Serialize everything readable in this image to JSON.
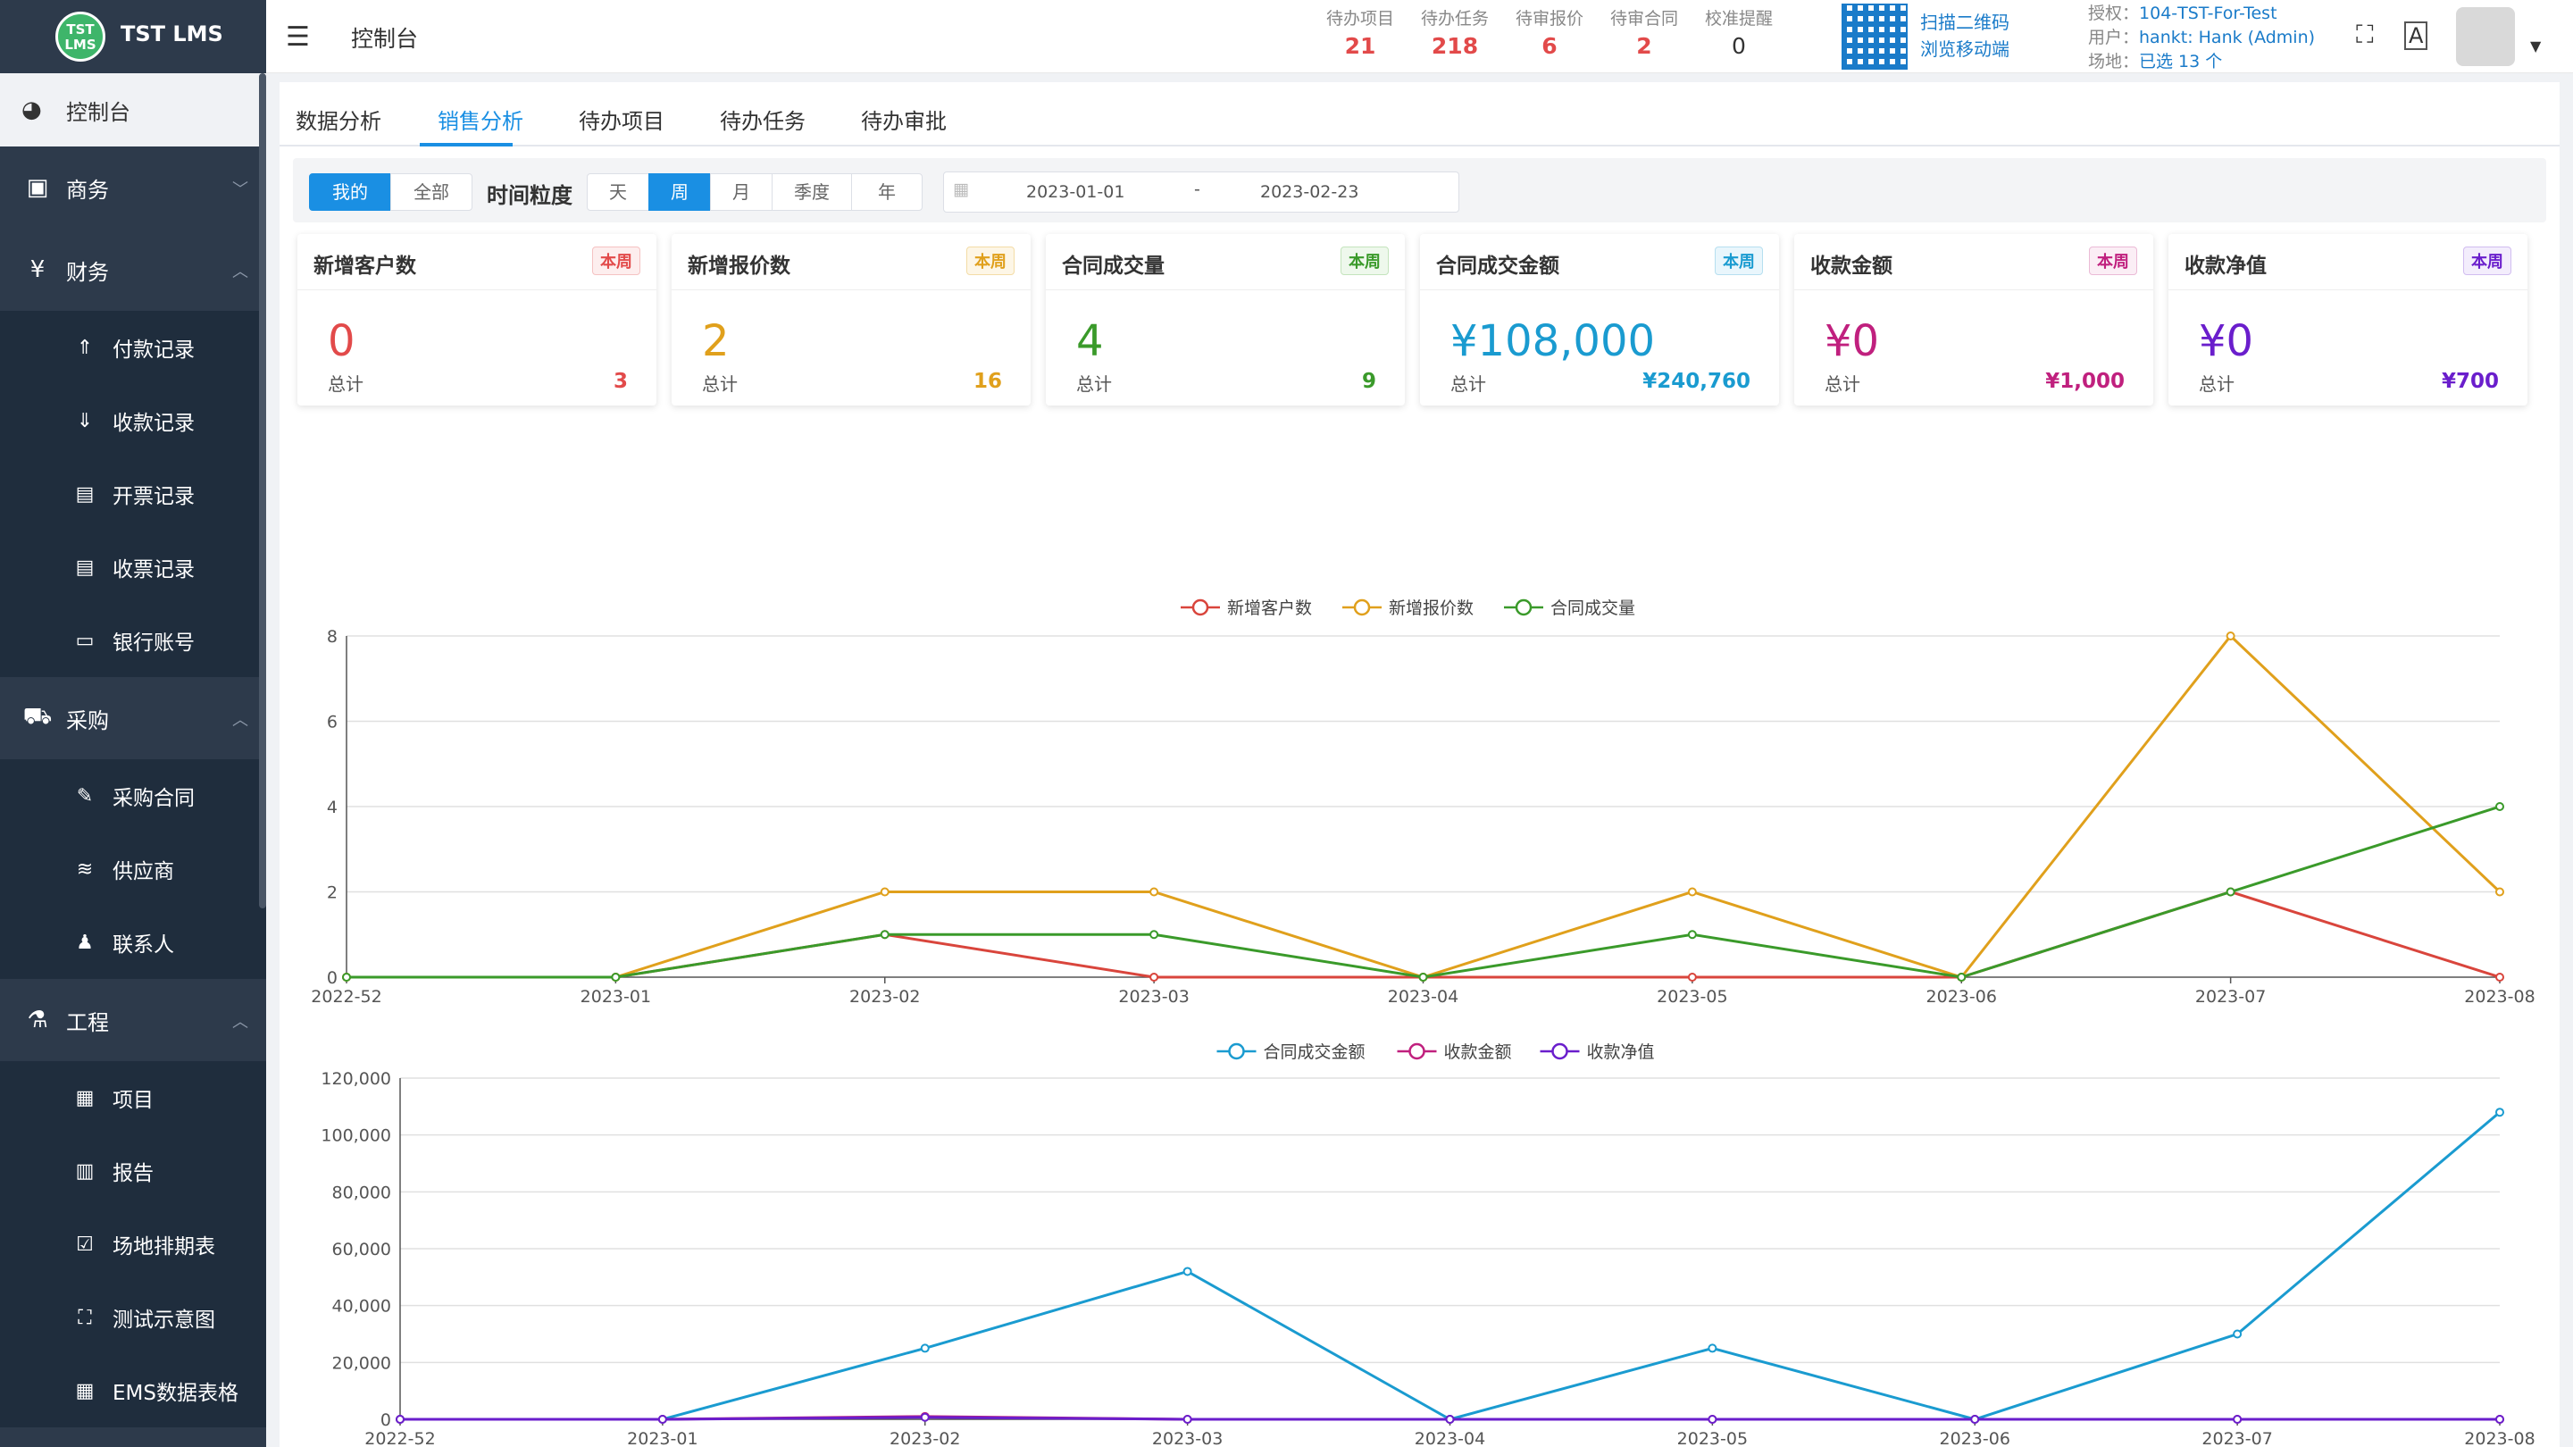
{
  "app": {
    "logo_badge": "TST LMS",
    "title": "TST LMS"
  },
  "sidebar": {
    "active": "控制台",
    "groups": [
      {
        "label": "商务",
        "icon": "briefcase-icon",
        "items": []
      },
      {
        "label": "财务",
        "icon": "yen-icon",
        "items": [
          "付款记录",
          "收款记录",
          "开票记录",
          "收票记录",
          "银行账号"
        ]
      },
      {
        "label": "采购",
        "icon": "cart-icon",
        "items": [
          "采购合同",
          "供应商",
          "联系人"
        ]
      },
      {
        "label": "工程",
        "icon": "flask-icon",
        "items": [
          "项目",
          "报告",
          "场地排期表",
          "测试示意图",
          "EMS数据表格"
        ]
      }
    ]
  },
  "header": {
    "breadcrumb": "控制台",
    "counters": [
      {
        "label": "待办项目",
        "value": "21"
      },
      {
        "label": "待办任务",
        "value": "218"
      },
      {
        "label": "待审报价",
        "value": "6"
      },
      {
        "label": "待审合同",
        "value": "2"
      },
      {
        "label": "校准提醒",
        "value": "0"
      }
    ],
    "qr_text1": "扫描二维码",
    "qr_text2": "浏览移动端",
    "license_label": "授权：",
    "license": "104-TST-For-Test",
    "user_label": "用户：",
    "user": "hankt: Hank (Admin)",
    "site_label": "场地：",
    "site": "已选 13 个"
  },
  "tabs": [
    "数据分析",
    "销售分析",
    "待办项目",
    "待办任务",
    "待办审批"
  ],
  "active_tab": "销售分析",
  "filter": {
    "scope": [
      "我的",
      "全部"
    ],
    "granularity_label": "时间粒度",
    "granularity": [
      "天",
      "周",
      "月",
      "季度",
      "年"
    ],
    "active_granularity": "周",
    "date_from": "2023-01-01",
    "date_sep": "-",
    "date_to": "2023-02-23"
  },
  "cards": [
    {
      "title": "新增客户数",
      "tag": "本周",
      "value": "0",
      "total_label": "总计",
      "total": "3",
      "color": "#e24a4a"
    },
    {
      "title": "新增报价数",
      "tag": "本周",
      "value": "2",
      "total_label": "总计",
      "total": "16",
      "color": "#e0a01c"
    },
    {
      "title": "合同成交量",
      "tag": "本周",
      "value": "4",
      "total_label": "总计",
      "total": "9",
      "color": "#3a9a2a"
    },
    {
      "title": "合同成交金额",
      "tag": "本周",
      "value": "¥108,000",
      "total_label": "总计",
      "total": "¥240,760",
      "color": "#1a9bd0"
    },
    {
      "title": "收款金额",
      "tag": "本周",
      "value": "¥0",
      "total_label": "总计",
      "total": "¥1,000",
      "color": "#c0207e"
    },
    {
      "title": "收款净值",
      "tag": "本周",
      "value": "¥0",
      "total_label": "总计",
      "total": "¥700",
      "color": "#6a1ecc"
    }
  ],
  "chart_data": [
    {
      "type": "line",
      "x": [
        "2022-52",
        "2023-01",
        "2023-02",
        "2023-03",
        "2023-04",
        "2023-05",
        "2023-06",
        "2023-07",
        "2023-08"
      ],
      "ylim": [
        0,
        8
      ],
      "yticks": [
        0,
        2,
        4,
        6,
        8
      ],
      "legend": "top-center",
      "grid": true,
      "series": [
        {
          "name": "新增客户数",
          "color": "#d9453c",
          "values": [
            0,
            0,
            1,
            0,
            0,
            0,
            0,
            2,
            0
          ]
        },
        {
          "name": "新增报价数",
          "color": "#e0a01c",
          "values": [
            0,
            0,
            2,
            2,
            0,
            2,
            0,
            8,
            2
          ]
        },
        {
          "name": "合同成交量",
          "color": "#3a9a2a",
          "values": [
            0,
            0,
            1,
            1,
            0,
            1,
            0,
            2,
            4
          ]
        }
      ]
    },
    {
      "type": "line",
      "x": [
        "2022-52",
        "2023-01",
        "2023-02",
        "2023-03",
        "2023-04",
        "2023-05",
        "2023-06",
        "2023-07",
        "2023-08"
      ],
      "ylim": [
        0,
        120000
      ],
      "yticks": [
        0,
        20000,
        40000,
        60000,
        80000,
        100000,
        120000
      ],
      "legend": "top-center",
      "grid": true,
      "series": [
        {
          "name": "合同成交金额",
          "color": "#1a9bd0",
          "values": [
            0,
            0,
            25000,
            52000,
            0,
            25000,
            0,
            30000,
            108000
          ]
        },
        {
          "name": "收款金额",
          "color": "#c0207e",
          "values": [
            0,
            0,
            1000,
            0,
            0,
            0,
            0,
            0,
            0
          ]
        },
        {
          "name": "收款净值",
          "color": "#6a1ecc",
          "values": [
            0,
            0,
            700,
            0,
            0,
            0,
            0,
            0,
            0
          ]
        }
      ]
    }
  ]
}
